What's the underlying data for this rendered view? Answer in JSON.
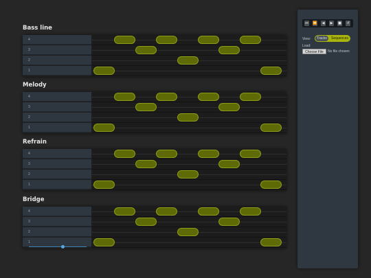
{
  "sections": [
    {
      "title": "Bass line",
      "rows": [
        "4",
        "3",
        "2",
        "1"
      ]
    },
    {
      "title": "Melody",
      "rows": [
        "4",
        "3",
        "2",
        "1"
      ]
    },
    {
      "title": "Refrain",
      "rows": [
        "4",
        "3",
        "2",
        "1"
      ]
    },
    {
      "title": "Bridge",
      "rows": [
        "4",
        "3",
        "2",
        "1"
      ]
    }
  ],
  "panel": {
    "transport": {
      "buttons": [
        "⏮",
        "⏪",
        "◀",
        "▶",
        "■",
        "↺"
      ]
    },
    "view_label": "View:",
    "view_options": [
      "Tracks",
      "Sequences"
    ],
    "view_selected": "Sequences",
    "load_label": "Load:",
    "choose_file_label": "Choose File",
    "file_status": "No file chosen"
  },
  "bridge_slider": {
    "value": 0.55
  },
  "colors": {
    "note_fill": "#5e6a05",
    "note_border": "#8e9c15",
    "toggle_active": "#a9b40c",
    "slider": "#3c84b4"
  }
}
